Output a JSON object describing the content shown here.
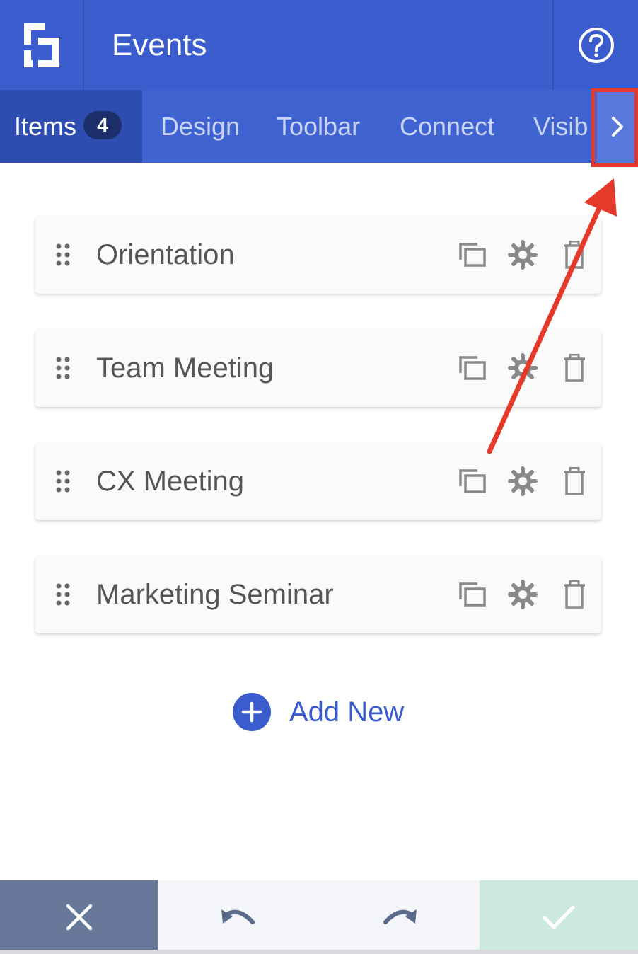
{
  "header": {
    "title": "Events"
  },
  "tabs": [
    {
      "label": "Items",
      "badge": "4",
      "active": true
    },
    {
      "label": "Design"
    },
    {
      "label": "Toolbar"
    },
    {
      "label": "Connect"
    },
    {
      "label": "Visib"
    }
  ],
  "items": [
    {
      "label": "Orientation"
    },
    {
      "label": "Team Meeting"
    },
    {
      "label": "CX Meeting"
    },
    {
      "label": "Marketing Seminar"
    }
  ],
  "add_new": {
    "label": "Add New"
  },
  "icons": {
    "logo": "brand-logo-icon",
    "help": "help-circle-icon",
    "next": "chevron-right-icon",
    "drag": "drag-handle-icon",
    "copy": "duplicate-icon",
    "settings": "gear-icon",
    "delete": "trash-icon",
    "add": "plus-circle-icon",
    "cancel": "close-icon",
    "undo": "undo-icon",
    "redo": "redo-icon",
    "confirm": "check-icon"
  },
  "colors": {
    "header": "#3a5ccc",
    "tab_bar": "#3f63d1",
    "tab_active": "#2e4db0",
    "accent": "#3a5ccc",
    "annotation": "#e53a2b",
    "cancel": "#68789a",
    "confirm": "#cbe9dc"
  }
}
